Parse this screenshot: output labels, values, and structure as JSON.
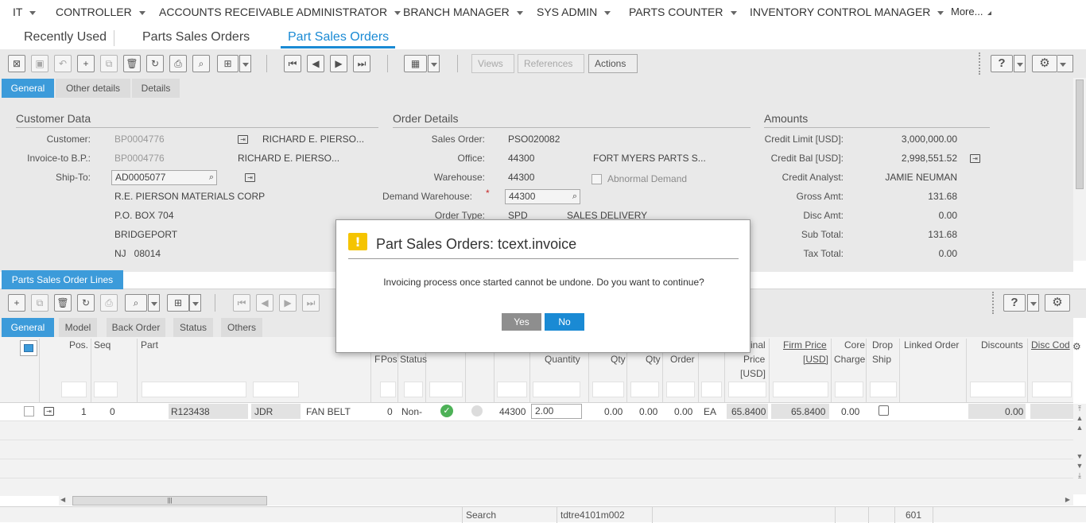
{
  "nav": {
    "items": [
      "IT",
      "CONTROLLER",
      "ACCOUNTS RECEIVABLE ADMINISTRATOR",
      "BRANCH MANAGER",
      "SYS ADMIN",
      "PARTS COUNTER",
      "INVENTORY CONTROL MANAGER",
      "More..."
    ]
  },
  "tabs": {
    "recent": "Recently Used",
    "tab1": "Parts Sales Orders",
    "tab2": "Part Sales Orders"
  },
  "toolbar": {
    "views": "Views",
    "references": "References",
    "actions": "Actions"
  },
  "header_tabs": [
    "General",
    "Other details",
    "Details"
  ],
  "customer": {
    "section": "Customer Data",
    "customer_label": "Customer:",
    "customer_code": "BP0004776",
    "customer_name": "RICHARD E. PIERSO...",
    "invoice_label": "Invoice-to B.P.:",
    "invoice_code": "BP0004776",
    "invoice_name": "RICHARD E. PIERSO...",
    "shipto_label": "Ship-To:",
    "shipto_code": "AD0005077",
    "addr1": "R.E. PIERSON MATERIALS CORP",
    "addr2": "P.O. BOX 704",
    "addr3": "BRIDGEPORT",
    "addr4": "NJ   08014"
  },
  "order": {
    "section": "Order Details",
    "so_label": "Sales Order:",
    "so_value": "PSO020082",
    "office_label": "Office:",
    "office_value": "44300",
    "office_name": "FORT MYERS PARTS S...",
    "wh_label": "Warehouse:",
    "wh_value": "44300",
    "abnormal": "Abnormal Demand",
    "dwh_label": "Demand Warehouse:",
    "dwh_value": "44300",
    "ot_label": "Order Type:",
    "ot_value": "SPD",
    "ot_name": "SALES DELIVERY"
  },
  "amounts": {
    "section": "Amounts",
    "rows": [
      {
        "label": "Credit Limit [USD]:",
        "value": "3,000,000.00"
      },
      {
        "label": "Credit Bal [USD]:",
        "value": "2,998,551.52"
      },
      {
        "label": "Credit Analyst:",
        "value": "JAMIE NEUMAN"
      },
      {
        "label": "Gross Amt:",
        "value": "131.68"
      },
      {
        "label": "Disc Amt:",
        "value": "0.00"
      },
      {
        "label": "Sub Total:",
        "value": "131.68"
      },
      {
        "label": "Tax Total:",
        "value": "0.00"
      }
    ]
  },
  "lines": {
    "title": "Parts Sales Order Lines",
    "tabs": [
      "General",
      "Model",
      "Back Order",
      "Status",
      "Others"
    ],
    "headers": {
      "pos": "Pos.",
      "seq": "Seq",
      "part": "Part",
      "f": "F",
      "pos2": "Pos",
      "status": "Status",
      "quantity": "Quantity",
      "qty1": "Qty",
      "qty2": "Qty",
      "order": "Order",
      "price1": "inal",
      "price2": "Price",
      "price3": "[USD]",
      "firm1": "Firm Price",
      "firm2": "[USD]",
      "core1": "Core",
      "core2": "Charge",
      "drop1": "Drop",
      "drop2": "Ship",
      "linked": "Linked Order",
      "discounts": "Discounts",
      "disccode": "Disc Cod"
    },
    "row": {
      "pos": "1",
      "seq": "0",
      "part": "R123438",
      "brand": "JDR",
      "desc": "FAN BELT",
      "zero": "0",
      "status": "Non-",
      "wh": "44300",
      "qty": "2.00",
      "q1": "0.00",
      "q2": "0.00",
      "q3": "0.00",
      "unit": "EA",
      "price": "65.8400",
      "firm": "65.8400",
      "core": "0.00",
      "discounts": "0.00"
    }
  },
  "dialog": {
    "title": "Part Sales Orders: tcext.invoice",
    "message": "Invoicing process once started cannot be undone. Do you want to continue?",
    "yes": "Yes",
    "no": "No"
  },
  "status": {
    "mode": "Search",
    "session": "tdtre4101m002",
    "company": "601"
  }
}
